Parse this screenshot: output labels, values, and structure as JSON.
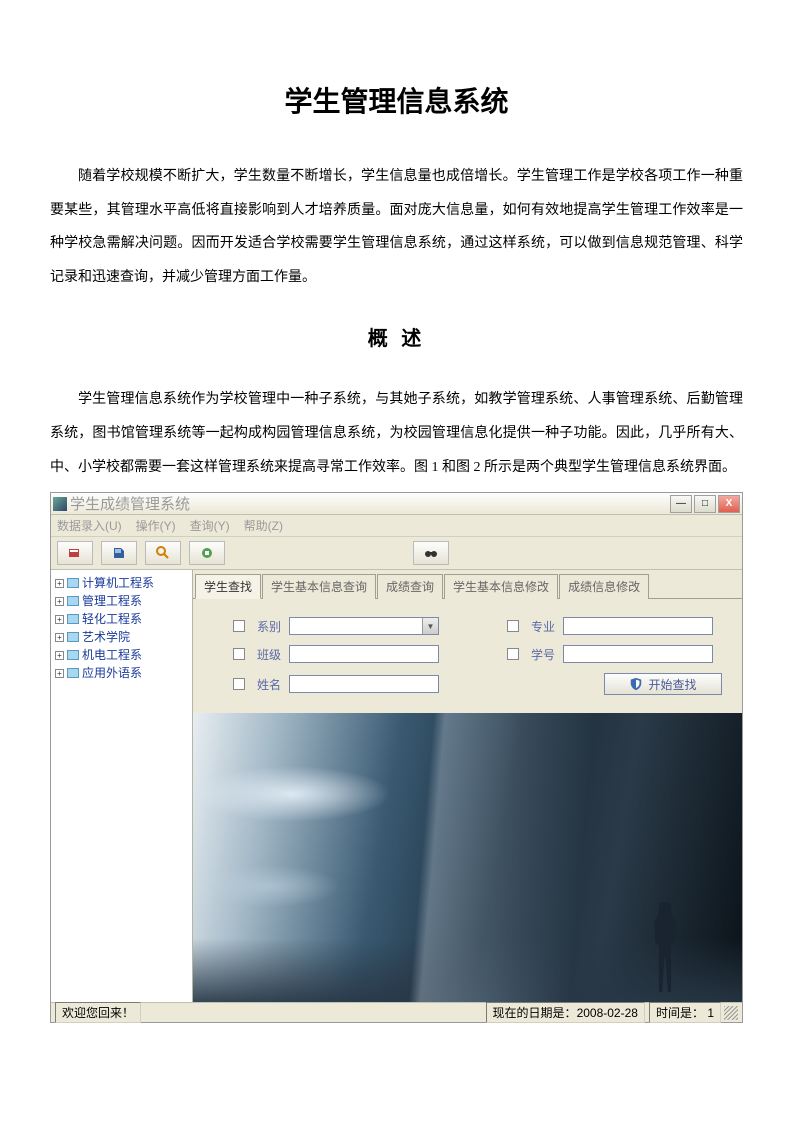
{
  "doc": {
    "title": "学生管理信息系统",
    "para1": "随着学校规模不断扩大，学生数量不断增长，学生信息量也成倍增长。学生管理工作是学校各项工作一种重要某些，其管理水平高低将直接影响到人才培养质量。面对庞大信息量，如何有效地提高学生管理工作效率是一种学校急需解决问题。因而开发适合学校需要学生管理信息系统，通过这样系统，可以做到信息规范管理、科学记录和迅速查询，并减少管理方面工作量。",
    "subtitle": "概  述",
    "para2": "学生管理信息系统作为学校管理中一种子系统，与其她子系统，如教学管理系统、人事管理系统、后勤管理系统，图书馆管理系统等一起构成构园管理信息系统，为校园管理信息化提供一种子功能。因此，几乎所有大、中、小学校都需要一套这样管理系统来提高寻常工作效率。图 1 和图 2 所示是两个典型学生管理信息系统界面。"
  },
  "app": {
    "title": "学生成绩管理系统",
    "menu": {
      "data": "数据录入(U)",
      "op": "操作(Y)",
      "query": "查询(Y)",
      "help": "帮助(Z)"
    },
    "tree": [
      "计算机工程系",
      "管理工程系",
      "轻化工程系",
      "艺术学院",
      "机电工程系",
      "应用外语系"
    ],
    "tabs": {
      "t0": "学生查找",
      "t1": "学生基本信息查询",
      "t2": "成绩查询",
      "t3": "学生基本信息修改",
      "t4": "成绩信息修改"
    },
    "form": {
      "dept": "系别",
      "major": "专业",
      "class": "班级",
      "sno": "学号",
      "name": "姓名",
      "search": "开始查找"
    },
    "status": {
      "welcome": "欢迎您回来！",
      "date_label": "现在的日期是：",
      "date": "2008-02-28",
      "time_label": "时间是：",
      "time": "1"
    }
  }
}
